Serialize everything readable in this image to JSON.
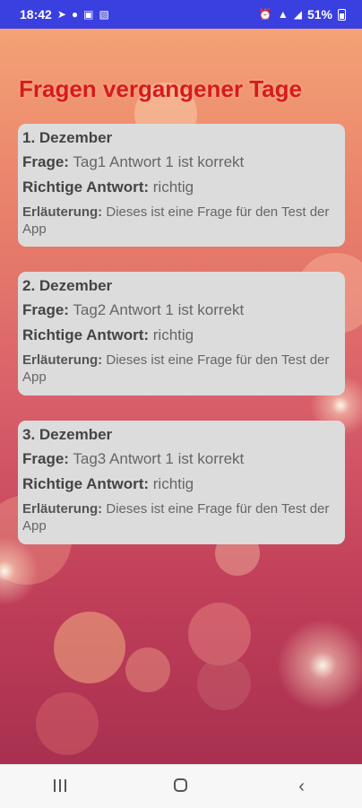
{
  "status_bar": {
    "time": "18:42",
    "battery": "51%",
    "icons": [
      "telegram-icon",
      "app-icon",
      "instagram-icon",
      "image-icon",
      "alarm-icon",
      "network-icon",
      "signal-icon",
      "battery-icon"
    ]
  },
  "page": {
    "title": "Fragen vergangener Tage"
  },
  "labels": {
    "question": "Frage:",
    "answer": "Richtige Antwort:",
    "explanation": "Erläuterung:"
  },
  "cards": [
    {
      "date": "1. Dezember",
      "question": "Tag1 Antwort 1 ist korrekt",
      "answer": "richtig",
      "explanation": "Dieses ist eine Frage für den Test der App"
    },
    {
      "date": "2. Dezember",
      "question": "Tag2 Antwort 1 ist korrekt",
      "answer": "richtig",
      "explanation": "Dieses ist eine Frage für den Test der App"
    },
    {
      "date": "3. Dezember",
      "question": "Tag3 Antwort 1 ist korrekt",
      "answer": "richtig",
      "explanation": "Dieses ist eine Frage für den Test der App"
    }
  ],
  "nav_bar": {
    "buttons": [
      "recents-icon",
      "home-icon",
      "back-icon"
    ]
  }
}
